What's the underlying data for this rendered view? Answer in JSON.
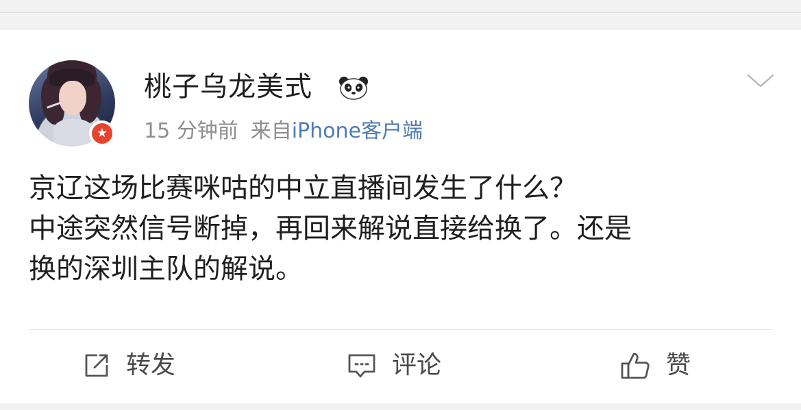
{
  "post": {
    "author": "桃子乌龙美式",
    "author_emoji": "panda-icon",
    "time": "15 分钟前",
    "source_prefix": "来自",
    "source_client": "iPhone客户端",
    "content_lines": [
      "京辽这场比赛咪咕的中立直播间发生了什么？",
      "中途突然信号断掉，再回来解说直接给换了。还是",
      "换的深圳主队的解说。"
    ]
  },
  "actions": {
    "repost_label": "转发",
    "comment_label": "评论",
    "like_label": "赞"
  },
  "colors": {
    "text": "#1f1f1f",
    "meta_gray": "#8e8e8e",
    "link_blue": "#4f7bb3",
    "badge_red": "#e8432e",
    "action_gray": "#4a4a4a"
  },
  "icons": [
    "avatar",
    "vip-badge-icon",
    "panda-icon",
    "chevron-down-icon",
    "repost-icon",
    "comment-icon",
    "like-icon"
  ]
}
